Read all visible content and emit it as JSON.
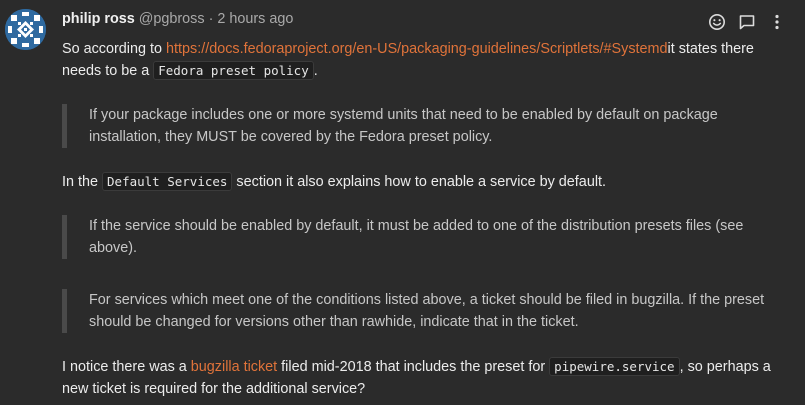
{
  "post": {
    "username": "philip ross",
    "handle": "@pgbross",
    "separator": "·",
    "time": "2 hours ago",
    "actions": {
      "react_icon": "smiley-icon",
      "reply_icon": "comment-icon",
      "more_icon": "vertical-dots-icon"
    },
    "p1": {
      "text_before": "So according to ",
      "link": "https://docs.fedoraproject.org/en-US/packaging-guidelines/Scriptlets/#Systemd",
      "text_after_link": "it states there needs to be a ",
      "code": "Fedora preset policy",
      "text_end": "."
    },
    "quote1": "If your package includes one or more systemd units that need to be enabled by default on package installation, they MUST be covered by the Fedora preset policy.",
    "p2": {
      "text_before": "In the ",
      "code": "Default Services",
      "text_after": " section it also explains how to enable a service by default."
    },
    "quote2": "If the service should be enabled by default, it must be added to one of the distribution presets files (see above).",
    "quote3": "For services which meet one of the conditions listed above, a ticket should be filed in bugzilla. If the preset should be changed for versions other than rawhide, indicate that in the ticket.",
    "p3": {
      "text_before": "I notice there was a ",
      "link": "bugzilla ticket",
      "text_middle": " filed mid-2018 that includes the preset for ",
      "code": "pipewire.service",
      "text_after": ", so perhaps a new ticket is required for the additional service?"
    }
  },
  "colors": {
    "background": "#2b2b2b",
    "text": "#ececec",
    "muted": "#a9a9a9",
    "link": "#e0733a",
    "quote_border": "#4a4a4a"
  }
}
